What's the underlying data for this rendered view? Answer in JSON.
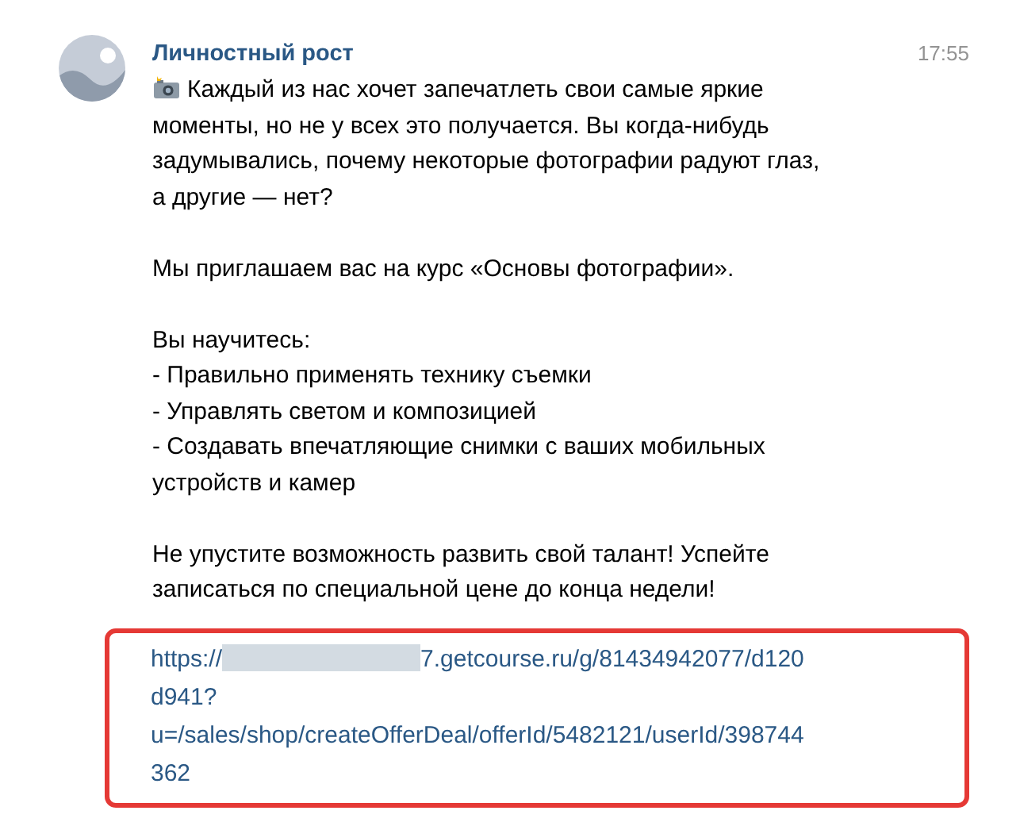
{
  "message": {
    "author": "Личностный рост",
    "time": "17:55",
    "paragraphs": [
      {
        "kind": "icon_text",
        "lines": [
          "Каждый из нас хочет запечатлеть свои самые яркие моменты, но не у всех это получается. Вы когда-нибудь задумывались, почему некоторые фотографии радуют глаз, а другие — нет?"
        ]
      },
      {
        "kind": "text",
        "lines": [
          "Мы приглашаем вас на курс «Основы фотографии»."
        ]
      },
      {
        "kind": "text",
        "lines": [
          "Вы научитесь:",
          "- Правильно применять технику съемки",
          "- Управлять светом и композицией",
          "- Создавать впечатляющие снимки с ваших мобильных устройств и камер"
        ]
      },
      {
        "kind": "text",
        "lines": [
          "Не упустите возможность развить свой талант! Успейте записаться по специальной цене до конца недели!"
        ]
      },
      {
        "kind": "link",
        "highlighted": true,
        "lines": [
          {
            "before": "https://",
            "redacted": true,
            "after": "7.getcourse.ru/g/81434942077/d120"
          },
          {
            "after": "d941?"
          },
          {
            "after": "u=/sales/shop/createOfferDeal/offerId/5482121/userId/398744"
          },
          {
            "after": "362"
          }
        ]
      }
    ]
  }
}
